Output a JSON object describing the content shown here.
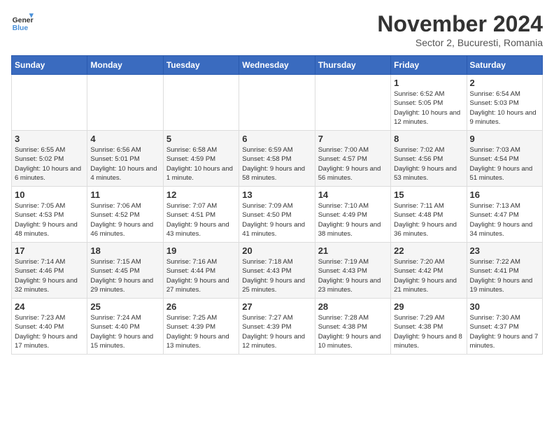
{
  "logo": {
    "line1": "General",
    "line2": "Blue"
  },
  "title": "November 2024",
  "subtitle": "Sector 2, Bucuresti, Romania",
  "weekdays": [
    "Sunday",
    "Monday",
    "Tuesday",
    "Wednesday",
    "Thursday",
    "Friday",
    "Saturday"
  ],
  "weeks": [
    [
      {
        "day": "",
        "info": ""
      },
      {
        "day": "",
        "info": ""
      },
      {
        "day": "",
        "info": ""
      },
      {
        "day": "",
        "info": ""
      },
      {
        "day": "",
        "info": ""
      },
      {
        "day": "1",
        "info": "Sunrise: 6:52 AM\nSunset: 5:05 PM\nDaylight: 10 hours and 12 minutes."
      },
      {
        "day": "2",
        "info": "Sunrise: 6:54 AM\nSunset: 5:03 PM\nDaylight: 10 hours and 9 minutes."
      }
    ],
    [
      {
        "day": "3",
        "info": "Sunrise: 6:55 AM\nSunset: 5:02 PM\nDaylight: 10 hours and 6 minutes."
      },
      {
        "day": "4",
        "info": "Sunrise: 6:56 AM\nSunset: 5:01 PM\nDaylight: 10 hours and 4 minutes."
      },
      {
        "day": "5",
        "info": "Sunrise: 6:58 AM\nSunset: 4:59 PM\nDaylight: 10 hours and 1 minute."
      },
      {
        "day": "6",
        "info": "Sunrise: 6:59 AM\nSunset: 4:58 PM\nDaylight: 9 hours and 58 minutes."
      },
      {
        "day": "7",
        "info": "Sunrise: 7:00 AM\nSunset: 4:57 PM\nDaylight: 9 hours and 56 minutes."
      },
      {
        "day": "8",
        "info": "Sunrise: 7:02 AM\nSunset: 4:56 PM\nDaylight: 9 hours and 53 minutes."
      },
      {
        "day": "9",
        "info": "Sunrise: 7:03 AM\nSunset: 4:54 PM\nDaylight: 9 hours and 51 minutes."
      }
    ],
    [
      {
        "day": "10",
        "info": "Sunrise: 7:05 AM\nSunset: 4:53 PM\nDaylight: 9 hours and 48 minutes."
      },
      {
        "day": "11",
        "info": "Sunrise: 7:06 AM\nSunset: 4:52 PM\nDaylight: 9 hours and 46 minutes."
      },
      {
        "day": "12",
        "info": "Sunrise: 7:07 AM\nSunset: 4:51 PM\nDaylight: 9 hours and 43 minutes."
      },
      {
        "day": "13",
        "info": "Sunrise: 7:09 AM\nSunset: 4:50 PM\nDaylight: 9 hours and 41 minutes."
      },
      {
        "day": "14",
        "info": "Sunrise: 7:10 AM\nSunset: 4:49 PM\nDaylight: 9 hours and 38 minutes."
      },
      {
        "day": "15",
        "info": "Sunrise: 7:11 AM\nSunset: 4:48 PM\nDaylight: 9 hours and 36 minutes."
      },
      {
        "day": "16",
        "info": "Sunrise: 7:13 AM\nSunset: 4:47 PM\nDaylight: 9 hours and 34 minutes."
      }
    ],
    [
      {
        "day": "17",
        "info": "Sunrise: 7:14 AM\nSunset: 4:46 PM\nDaylight: 9 hours and 32 minutes."
      },
      {
        "day": "18",
        "info": "Sunrise: 7:15 AM\nSunset: 4:45 PM\nDaylight: 9 hours and 29 minutes."
      },
      {
        "day": "19",
        "info": "Sunrise: 7:16 AM\nSunset: 4:44 PM\nDaylight: 9 hours and 27 minutes."
      },
      {
        "day": "20",
        "info": "Sunrise: 7:18 AM\nSunset: 4:43 PM\nDaylight: 9 hours and 25 minutes."
      },
      {
        "day": "21",
        "info": "Sunrise: 7:19 AM\nSunset: 4:43 PM\nDaylight: 9 hours and 23 minutes."
      },
      {
        "day": "22",
        "info": "Sunrise: 7:20 AM\nSunset: 4:42 PM\nDaylight: 9 hours and 21 minutes."
      },
      {
        "day": "23",
        "info": "Sunrise: 7:22 AM\nSunset: 4:41 PM\nDaylight: 9 hours and 19 minutes."
      }
    ],
    [
      {
        "day": "24",
        "info": "Sunrise: 7:23 AM\nSunset: 4:40 PM\nDaylight: 9 hours and 17 minutes."
      },
      {
        "day": "25",
        "info": "Sunrise: 7:24 AM\nSunset: 4:40 PM\nDaylight: 9 hours and 15 minutes."
      },
      {
        "day": "26",
        "info": "Sunrise: 7:25 AM\nSunset: 4:39 PM\nDaylight: 9 hours and 13 minutes."
      },
      {
        "day": "27",
        "info": "Sunrise: 7:27 AM\nSunset: 4:39 PM\nDaylight: 9 hours and 12 minutes."
      },
      {
        "day": "28",
        "info": "Sunrise: 7:28 AM\nSunset: 4:38 PM\nDaylight: 9 hours and 10 minutes."
      },
      {
        "day": "29",
        "info": "Sunrise: 7:29 AM\nSunset: 4:38 PM\nDaylight: 9 hours and 8 minutes."
      },
      {
        "day": "30",
        "info": "Sunrise: 7:30 AM\nSunset: 4:37 PM\nDaylight: 9 hours and 7 minutes."
      }
    ]
  ]
}
